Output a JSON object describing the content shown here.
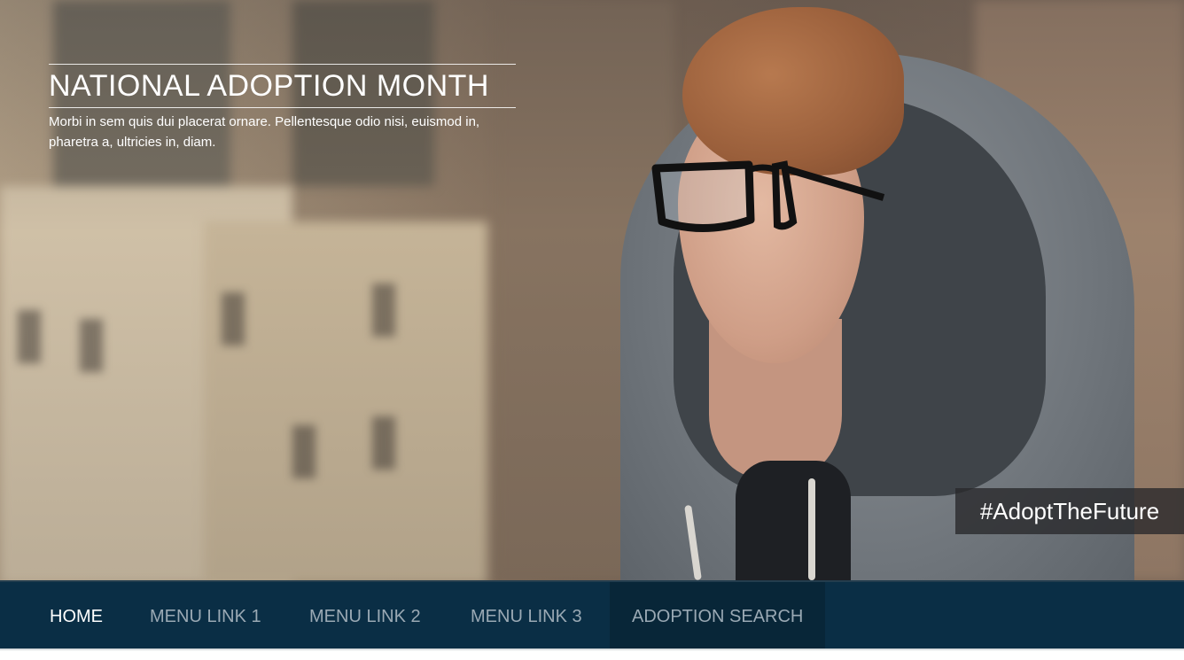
{
  "hero": {
    "title": "NATIONAL ADOPTION MONTH",
    "subtitle": "Morbi in sem quis dui placerat ornare. Pellentesque odio nisi, euismod in, pharetra a, ultricies in, diam.",
    "hashtag": "#AdoptTheFuture"
  },
  "nav": {
    "items": [
      {
        "label": "HOME",
        "active": true
      },
      {
        "label": "MENU LINK 1"
      },
      {
        "label": "MENU LINK 2"
      },
      {
        "label": "MENU LINK 3"
      },
      {
        "label": "ADOPTION SEARCH"
      }
    ]
  },
  "colors": {
    "nav_background": "#0a2e45",
    "nav_highlight": "#082638",
    "nav_text": "#9aa9b4",
    "active_text": "#ffffff",
    "hashtag_background": "#28282a"
  }
}
